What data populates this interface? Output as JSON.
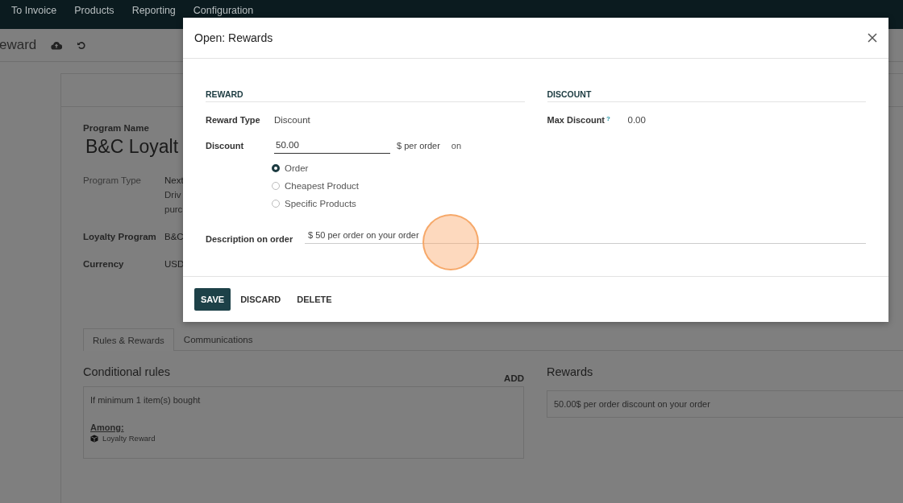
{
  "nav": {
    "items": [
      "To Invoice",
      "Products",
      "Reporting",
      "Configuration"
    ]
  },
  "breadcrumb": {
    "title": "eward"
  },
  "program": {
    "name_label": "Program Name",
    "name": "B&C Loyalt",
    "fields": [
      {
        "label": "Program Type",
        "value": "Next",
        "lines": [
          "Driv",
          "purc"
        ],
        "kind": "plain"
      },
      {
        "label": "Loyalty Program",
        "value": "B&C",
        "kind": "bold"
      },
      {
        "label": "Currency",
        "value": "USD",
        "kind": "bold"
      }
    ]
  },
  "tabs": [
    {
      "label": "Rules & Rewards",
      "selected": true
    },
    {
      "label": "Communications",
      "selected": false
    }
  ],
  "rules": {
    "heading": "Conditional rules",
    "add": "ADD",
    "condition": "If minimum 1 item(s) bought",
    "among_label": "Among:",
    "product": "Loyalty Reward"
  },
  "rewards": {
    "heading": "Rewards",
    "items": [
      "50.00$ per order discount on your order"
    ]
  },
  "dialog": {
    "title": "Open: Rewards",
    "reward": {
      "heading": "REWARD",
      "reward_type": {
        "label": "Reward Type",
        "value": "Discount"
      },
      "discount": {
        "label": "Discount",
        "value": "50.00",
        "unit": "$ per order",
        "suffix": "on"
      },
      "apply_on": [
        {
          "label": "Order",
          "selected": true
        },
        {
          "label": "Cheapest Product",
          "selected": false
        },
        {
          "label": "Specific Products",
          "selected": false
        }
      ],
      "description": {
        "label": "Description on order",
        "value": "$ 50 per order on your order"
      }
    },
    "discount": {
      "heading": "DISCOUNT",
      "max_discount": {
        "label": "Max Discount",
        "help": "?",
        "value": "0.00"
      }
    },
    "buttons": [
      {
        "label": "SAVE",
        "kind": "primary"
      },
      {
        "label": "DISCARD",
        "kind": "plain"
      },
      {
        "label": "DELETE",
        "kind": "plain"
      }
    ]
  }
}
